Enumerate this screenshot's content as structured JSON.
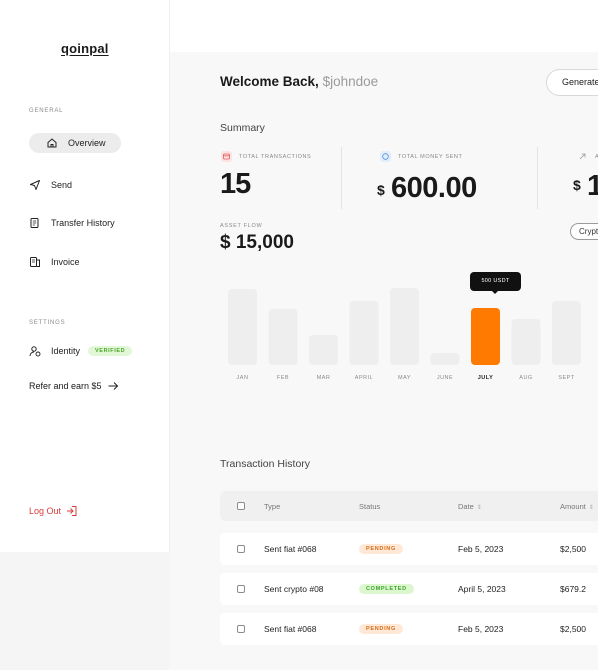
{
  "app": {
    "logo": "qoinpal"
  },
  "sidebar": {
    "general_label": "GENERAL",
    "items": [
      {
        "label": "Overview",
        "icon": "home-icon",
        "active": true
      },
      {
        "label": "Send",
        "icon": "send-icon"
      },
      {
        "label": "Transfer History",
        "icon": "receipt-icon"
      },
      {
        "label": "Invoice",
        "icon": "invoice-icon"
      }
    ],
    "settings_label": "SETTINGS",
    "identity": {
      "label": "Identity",
      "badge": "VERIFIED",
      "icon": "user-check-icon"
    },
    "refer": {
      "label": "Refer and earn $5",
      "icon": "arrow-right-icon"
    },
    "logout": {
      "label": "Log Out",
      "icon": "logout-icon"
    }
  },
  "header": {
    "welcome": "Welcome Back,",
    "username": "$johndoe",
    "generate_button": "Generate"
  },
  "summary": {
    "title": "Summary",
    "stats": [
      {
        "label": "TOTAL TRANSACTIONS",
        "value": "15",
        "icon": "card-icon",
        "color": "#e05a5a"
      },
      {
        "label": "TOTAL MONEY SENT",
        "currency": "$",
        "value": "600.00",
        "icon": "coin-icon",
        "color": "#4a8fe0"
      },
      {
        "label": "A",
        "currency": "$",
        "value": "1",
        "icon": "arrow-up-icon",
        "color": "#999999"
      }
    ],
    "asset_flow_label": "ASSET FLOW",
    "asset_flow_value": "$ 15,000",
    "filter_pill": "Crypt"
  },
  "chart_data": {
    "type": "bar",
    "categories": [
      "JAN",
      "FEB",
      "MAR",
      "APRIL",
      "MAY",
      "JUNE",
      "JULY",
      "AUG",
      "SEPT"
    ],
    "values": [
      76,
      56,
      30,
      64,
      77,
      12,
      57,
      46,
      64
    ],
    "highlight_index": 6,
    "tooltip": "500 USDT",
    "accent": "#ff7a00"
  },
  "transactions": {
    "title": "Transaction History",
    "columns": [
      "Type",
      "Status",
      "Date",
      "Amount"
    ],
    "rows": [
      {
        "type": "Sent fiat #068",
        "status": "PENDING",
        "date": "Feb 5, 2023",
        "amount": "$2,500"
      },
      {
        "type": "Sent crypto #08",
        "status": "COMPLETED",
        "date": "April 5, 2023",
        "amount": "$679.2"
      },
      {
        "type": "Sent fiat #068",
        "status": "PENDING",
        "date": "Feb 5, 2023",
        "amount": "$2,500"
      }
    ]
  }
}
